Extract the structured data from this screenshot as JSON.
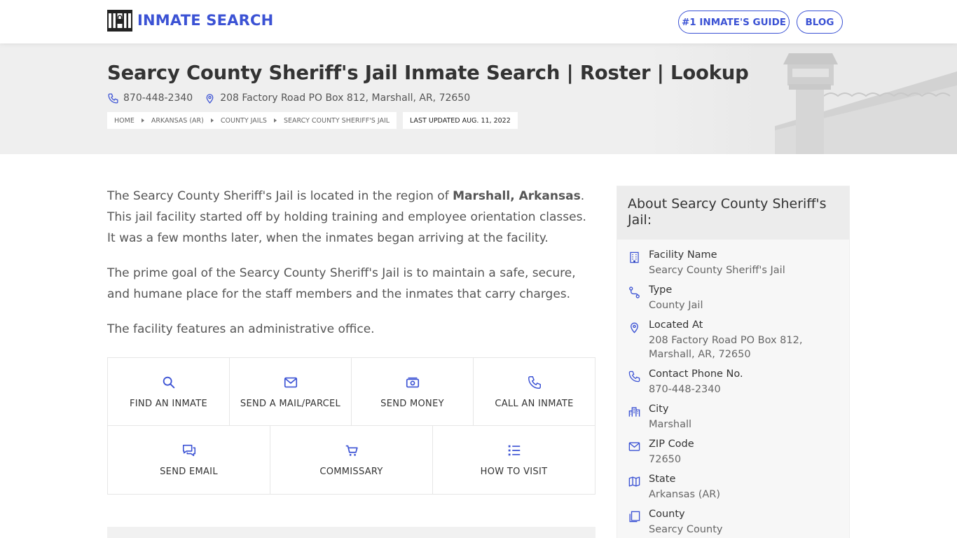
{
  "header": {
    "logo_text": "INMATE SEARCH",
    "nav": {
      "guide": "#1 INMATE'S GUIDE",
      "blog": "BLOG"
    }
  },
  "hero": {
    "title": "Searcy County Sheriff's Jail Inmate Search | Roster | Lookup",
    "phone": "870-448-2340",
    "address": "208 Factory Road PO Box 812, Marshall, AR, 72650",
    "breadcrumbs": [
      "HOME",
      "ARKANSAS (AR)",
      "COUNTY JAILS",
      "SEARCY COUNTY SHERIFF'S JAIL"
    ],
    "last_updated": "LAST UPDATED AUG. 11, 2022"
  },
  "content": {
    "p1_a": "The Searcy County Sheriff's Jail is located in the region of ",
    "p1_bold": "Marshall, Arkansas",
    "p1_b": ". This jail facility started off by holding training and employee orientation classes. It was a few months later, when the inmates began arriving at the facility.",
    "p2": "The prime goal of the Searcy County Sheriff's Jail is to maintain a safe, secure, and humane place for the staff members and the inmates that carry charges.",
    "p3": "The facility features an administrative office."
  },
  "actions": {
    "row1": [
      "FIND AN INMATE",
      "SEND A MAIL/PARCEL",
      "SEND MONEY",
      "CALL AN INMATE"
    ],
    "row2": [
      "SEND EMAIL",
      "COMMISSARY",
      "HOW TO VISIT"
    ]
  },
  "sidebar": {
    "title": "About Searcy County Sheriff's Jail:",
    "items": [
      {
        "label": "Facility Name",
        "value": "Searcy County Sheriff's Jail",
        "icon": "building-icon"
      },
      {
        "label": "Type",
        "value": "County Jail",
        "icon": "route-icon"
      },
      {
        "label": "Located At",
        "value": "208 Factory Road PO Box 812, Marshall, AR, 72650",
        "icon": "location-icon"
      },
      {
        "label": "Contact Phone No.",
        "value": "870-448-2340",
        "icon": "phone-icon"
      },
      {
        "label": "City",
        "value": "Marshall",
        "icon": "city-icon"
      },
      {
        "label": "ZIP Code",
        "value": "72650",
        "icon": "mail-icon"
      },
      {
        "label": "State",
        "value": "Arkansas (AR)",
        "icon": "map-icon"
      },
      {
        "label": "County",
        "value": "Searcy County",
        "icon": "copy-icon"
      }
    ]
  },
  "colors": {
    "accent": "#3b52d4",
    "hero_bg": "#efefef",
    "text": "#555555"
  }
}
